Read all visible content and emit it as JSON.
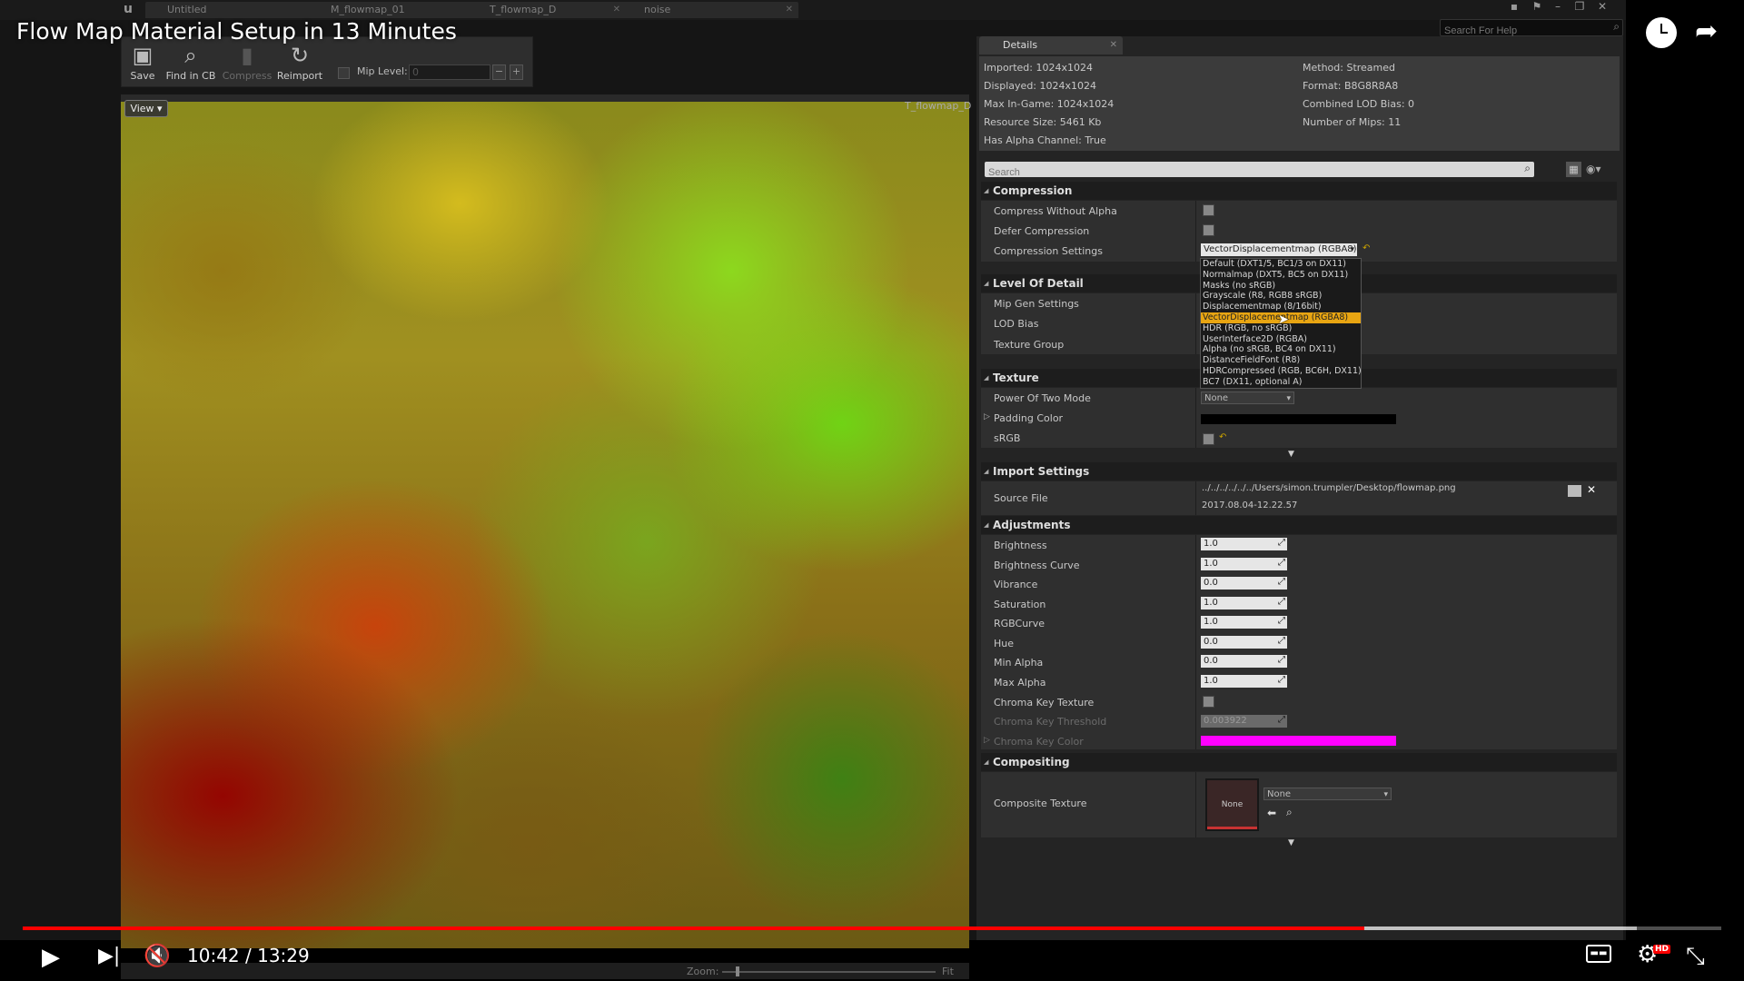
{
  "video": {
    "title": "Flow Map Material Setup in 13 Minutes",
    "time": "10:42 / 13:29",
    "progress_fraction": 0.79,
    "buffered_fraction": 0.95
  },
  "tabs": [
    {
      "label": "Untitled"
    },
    {
      "label": "M_flowmap_01"
    },
    {
      "label": "T_flowmap_D"
    },
    {
      "label": "noise"
    }
  ],
  "help_search": {
    "placeholder": "Search For Help"
  },
  "toolbar": {
    "save": "Save",
    "find_in_cb": "Find in CB",
    "compress": "Compress",
    "reimport": "Reimport",
    "mip_level_label": "Mip Level:",
    "mip_level_value": "0",
    "minus": "−",
    "plus": "+"
  },
  "viewport": {
    "view_button": "View ▾",
    "texture_name": "T_flowmap_D",
    "zoom_label": "Zoom:",
    "fit_label": "Fit"
  },
  "details": {
    "tab": "Details",
    "info": {
      "imported": "Imported: 1024x1024",
      "displayed": "Displayed: 1024x1024",
      "max_in_game": "Max In-Game: 1024x1024",
      "resource_size": "Resource Size: 5461 Kb",
      "has_alpha": "Has Alpha Channel: True",
      "method": "Method: Streamed",
      "format": "Format: B8G8R8A8",
      "combined_lod": "Combined LOD Bias: 0",
      "num_mips": "Number of Mips: 11"
    },
    "search_placeholder": "Search",
    "sections": {
      "compression": "Compression",
      "lod": "Level Of Detail",
      "texture": "Texture",
      "import": "Import Settings",
      "adjustments": "Adjustments",
      "compositing": "Compositing"
    },
    "compression": {
      "compress_without_alpha": "Compress Without Alpha",
      "defer_compression": "Defer Compression",
      "compression_settings": "Compression Settings",
      "compression_value": "VectorDisplacementmap (RGBA8)"
    },
    "dropdown_options": [
      "Default (DXT1/5, BC1/3 on DX11)",
      "Normalmap (DXT5, BC5 on DX11)",
      "Masks (no sRGB)",
      "Grayscale (R8, RGB8 sRGB)",
      "Displacementmap (8/16bit)",
      "VectorDisplacementmap (RGBA8)",
      "HDR (RGB, no sRGB)",
      "UserInterface2D (RGBA)",
      "Alpha (no sRGB, BC4 on DX11)",
      "DistanceFieldFont (R8)",
      "HDRCompressed (RGB, BC6H, DX11)",
      "BC7 (DX11, optional A)"
    ],
    "lod": {
      "mip_gen": "Mip Gen Settings",
      "lod_bias": "LOD Bias",
      "texture_group": "Texture Group"
    },
    "texture": {
      "power_of_two": "Power Of Two Mode",
      "power_of_two_value": "None",
      "padding_color": "Padding Color",
      "srgb": "sRGB"
    },
    "import": {
      "source_file": "Source File",
      "path": "../../../../../../Users/simon.trumpler/Desktop/flowmap.png",
      "date": "2017.08.04-12.22.57"
    },
    "adjustments": [
      {
        "label": "Brightness",
        "value": "1.0"
      },
      {
        "label": "Brightness Curve",
        "value": "1.0"
      },
      {
        "label": "Vibrance",
        "value": "0.0"
      },
      {
        "label": "Saturation",
        "value": "1.0"
      },
      {
        "label": "RGBCurve",
        "value": "1.0"
      },
      {
        "label": "Hue",
        "value": "0.0"
      },
      {
        "label": "Min Alpha",
        "value": "0.0"
      },
      {
        "label": "Max Alpha",
        "value": "1.0"
      }
    ],
    "chroma": {
      "texture": "Chroma Key Texture",
      "threshold": "Chroma Key Threshold",
      "threshold_value": "0.003922",
      "color": "Chroma Key Color"
    },
    "compositing": {
      "composite_texture": "Composite Texture",
      "thumb_label": "None",
      "value": "None"
    }
  },
  "colors": {
    "chroma_key": "#ff00ff",
    "padding": "#000000",
    "dropdown_selected": "#e8a512",
    "progress": "#ff0000"
  }
}
